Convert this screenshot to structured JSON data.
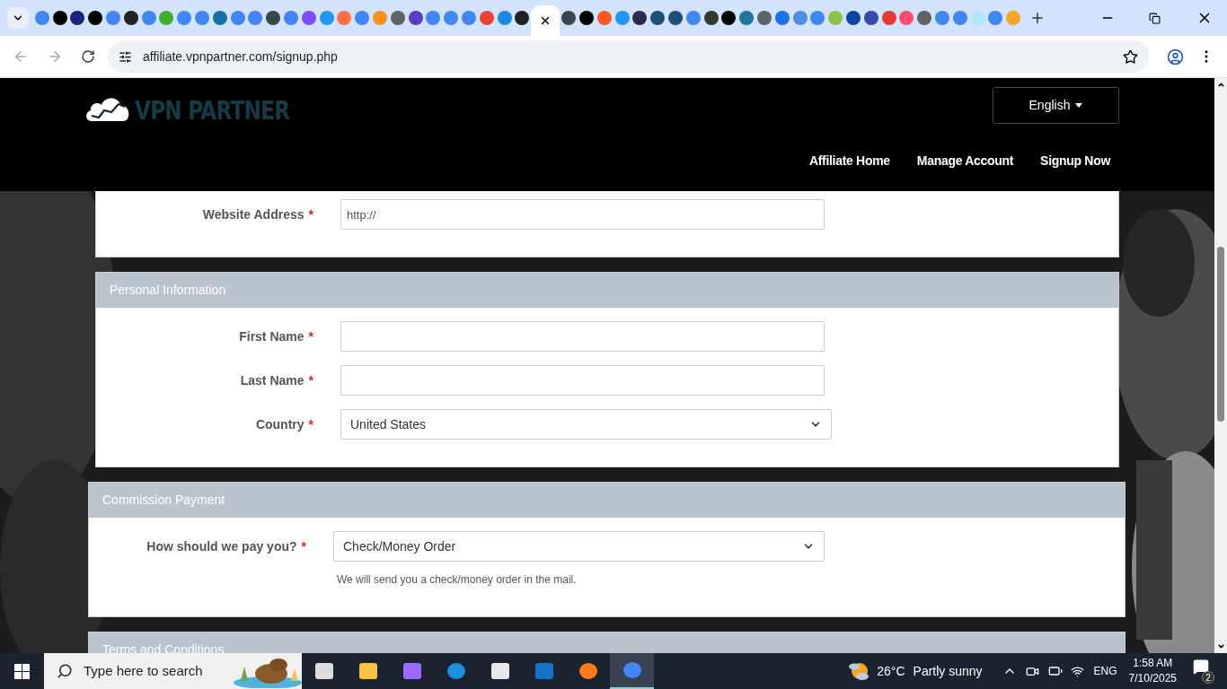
{
  "browser": {
    "tabs": [
      {
        "color": "#4285f4",
        "selected": false
      },
      {
        "color": "#000000",
        "selected": false
      },
      {
        "color": "#1a237e",
        "selected": false
      },
      {
        "color": "#000000",
        "selected": false
      },
      {
        "color": "#4285f4",
        "selected": false
      },
      {
        "color": "#222222",
        "selected": false
      },
      {
        "color": "#4285f4",
        "selected": false
      },
      {
        "color": "#3fae2a",
        "selected": false
      },
      {
        "color": "#4285f4",
        "selected": false
      },
      {
        "color": "#4285f4",
        "selected": false
      },
      {
        "color": "#1b6fa8",
        "selected": false
      },
      {
        "color": "#4285f4",
        "selected": false
      },
      {
        "color": "#4285f4",
        "selected": false
      },
      {
        "color": "#37474f",
        "selected": false
      },
      {
        "color": "#4285f4",
        "selected": false
      },
      {
        "color": "#7c4dff",
        "selected": false
      },
      {
        "color": "#2196f3",
        "selected": false
      },
      {
        "color": "#ff7043",
        "selected": false
      },
      {
        "color": "#4285f4",
        "selected": false
      },
      {
        "color": "#f7931a",
        "selected": false
      },
      {
        "color": "#5f6368",
        "selected": false
      },
      {
        "color": "#5b3cc4",
        "selected": false
      },
      {
        "color": "#4285f4",
        "selected": false
      },
      {
        "color": "#4285f4",
        "selected": false
      },
      {
        "color": "#4285f4",
        "selected": false
      },
      {
        "color": "#ea4335",
        "selected": false
      },
      {
        "color": "#1e88e5",
        "selected": false
      },
      {
        "color": "#212121",
        "selected": false
      },
      {
        "selected": true
      },
      {
        "color": "#37474f",
        "selected": false
      },
      {
        "color": "#000000",
        "selected": false
      },
      {
        "color": "#ff5722",
        "selected": false
      },
      {
        "color": "#2196f3",
        "selected": false
      },
      {
        "color": "#2b2b4b",
        "selected": false
      },
      {
        "color": "#1f4e79",
        "selected": false
      },
      {
        "color": "#1f4e79",
        "selected": false
      },
      {
        "color": "#4285f4",
        "selected": false
      },
      {
        "color": "#2e3b33",
        "selected": false
      },
      {
        "color": "#000000",
        "selected": false
      },
      {
        "color": "#21759b",
        "selected": false
      },
      {
        "color": "#5f6368",
        "selected": false
      },
      {
        "color": "#1a73e8",
        "selected": false
      },
      {
        "color": "#4a90e2",
        "selected": false
      },
      {
        "color": "#4285f4",
        "selected": false
      },
      {
        "color": "#8bc34a",
        "selected": false
      },
      {
        "color": "#0d47a1",
        "selected": false
      },
      {
        "color": "#3949ab",
        "selected": false
      },
      {
        "color": "#e53935",
        "selected": false
      },
      {
        "color": "#ff4d6d",
        "selected": false
      },
      {
        "color": "#5f6368",
        "selected": false
      },
      {
        "color": "#4285f4",
        "selected": false
      },
      {
        "color": "#4285f4",
        "selected": false
      },
      {
        "color": "#b3e5fc",
        "selected": false
      },
      {
        "color": "#4285f4",
        "selected": false
      },
      {
        "color": "#f5a623",
        "selected": false
      }
    ],
    "url": "affiliate.vpnpartner.com/signup.php"
  },
  "header": {
    "logo": "VPN PARTNER",
    "language": "English",
    "nav": [
      "Affiliate Home",
      "Manage Account",
      "Signup Now"
    ]
  },
  "sections": [
    {
      "fields": [
        {
          "label": "Website Address",
          "mark": "*",
          "kind": "input",
          "value": "http://"
        }
      ]
    },
    {
      "title": "Personal Information",
      "fields": [
        {
          "label": "First Name",
          "mark": "*",
          "kind": "input"
        },
        {
          "label": "Last Name",
          "mark": "*",
          "kind": "input"
        },
        {
          "label": "Country",
          "mark": "*",
          "kind": "select",
          "value": "United States"
        }
      ]
    },
    {
      "title": "Commission Payment",
      "fields": [
        {
          "label": "How should we pay you?",
          "mark": "*",
          "kind": "select",
          "value": "Check/Money Order",
          "help": "We will send you a check/money order in the mail."
        }
      ]
    },
    {
      "title": "Terms and Conditions"
    }
  ],
  "taskbar": {
    "search_placeholder": "Type here to search",
    "temperature": "26°C",
    "forecast": "Partly sunny",
    "language": "ENG",
    "time": "1:58 AM",
    "date": "7/10/2025",
    "notifications": "2"
  }
}
